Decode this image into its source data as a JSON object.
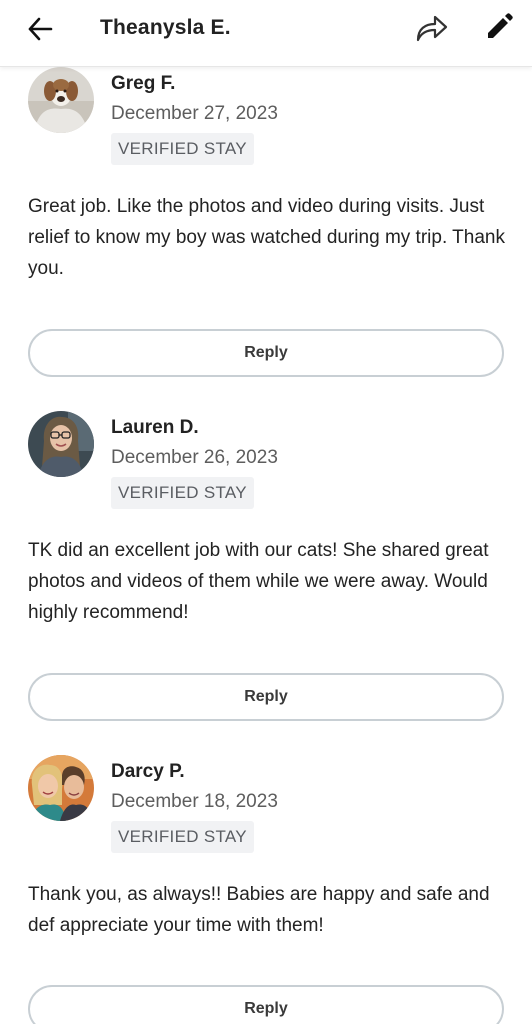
{
  "header": {
    "title": "Theanysla E.",
    "back_icon": "arrow-left-icon",
    "share_icon": "share-icon",
    "edit_icon": "pencil-icon"
  },
  "reviews": [
    {
      "name": "Greg F.",
      "date": "December 27, 2023",
      "badge": "VERIFIED STAY",
      "text": "Great job. Like the photos and video during visits. Just relief to know my boy was watched during my trip. Thank you.",
      "reply_label": "Reply"
    },
    {
      "name": "Lauren D.",
      "date": "December 26, 2023",
      "badge": "VERIFIED STAY",
      "text": "TK did an excellent job with our cats! She shared great photos and videos of them while we were away. Would highly recommend!",
      "reply_label": "Reply"
    },
    {
      "name": "Darcy P.",
      "date": "December 18, 2023",
      "badge": "VERIFIED STAY",
      "text": "Thank you, as always!! Babies are happy and safe and def appreciate your time with them!",
      "reply_label": "Reply"
    }
  ],
  "colors": {
    "badge_bg": "#f1f2f4",
    "reply_border": "#c8cfd4",
    "text": "#232323",
    "muted": "#5d5d5d"
  }
}
